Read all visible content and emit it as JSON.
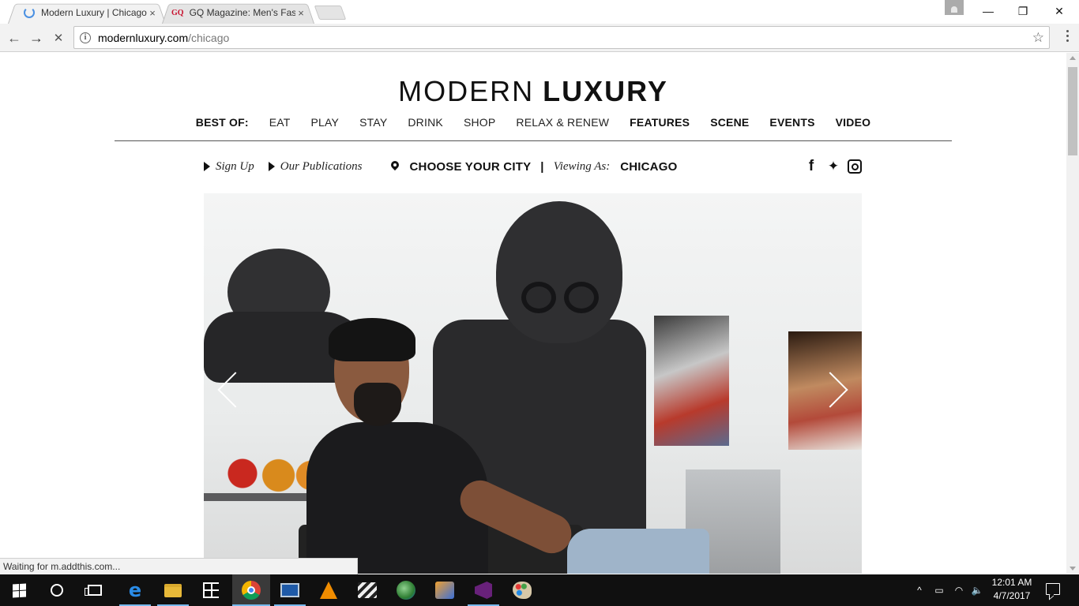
{
  "browser": {
    "tabs": [
      {
        "title": "Modern Luxury | Chicago",
        "close": "×",
        "active": true
      },
      {
        "title": "GQ Magazine: Men's Fas",
        "favicon": "GQ",
        "close": "×",
        "active": false
      }
    ],
    "window_controls": {
      "minimize": "—",
      "maximize": "❐",
      "close": "✕"
    },
    "nav": {
      "back": "←",
      "forward": "→",
      "stop": "✕"
    },
    "url_host": "modernluxury.com",
    "url_path": "/chicago",
    "bookmark_star": "☆",
    "status": "Waiting for m.addthis.com..."
  },
  "page": {
    "logo_light": "MODERN",
    "logo_bold": "LUXURY",
    "nav": [
      {
        "label": "BEST OF:",
        "strong": true
      },
      {
        "label": "EAT"
      },
      {
        "label": "PLAY"
      },
      {
        "label": "STAY"
      },
      {
        "label": "DRINK"
      },
      {
        "label": "SHOP"
      },
      {
        "label": "RELAX & RENEW"
      },
      {
        "label": "FEATURES",
        "strong": true
      },
      {
        "label": "SCENE",
        "strong": true
      },
      {
        "label": "EVENTS",
        "strong": true
      },
      {
        "label": "VIDEO",
        "strong": true
      }
    ],
    "sign_up": "Sign Up",
    "publications": "Our Publications",
    "choose_city": "CHOOSE YOUR CITY",
    "separator": "|",
    "viewing_as_label": "Viewing As:",
    "viewing_as_city": "CHICAGO",
    "social": {
      "facebook": "f",
      "twitter": "🐦"
    },
    "hero_alt": "Artist seated in studio with large black sculptures"
  },
  "taskbar": {
    "apps": [
      "start",
      "cortana",
      "task-view",
      "edge",
      "file-explorer",
      "store",
      "chrome",
      "remote-desktop",
      "vlc",
      "movie-maker",
      "globe",
      "paint",
      "visual-studio",
      "fresh-paint"
    ],
    "tray": {
      "chevron": "^",
      "battery": "▭",
      "wifi": "◠",
      "volume": "🔈"
    },
    "time": "12:01 AM",
    "date": "4/7/2017"
  }
}
